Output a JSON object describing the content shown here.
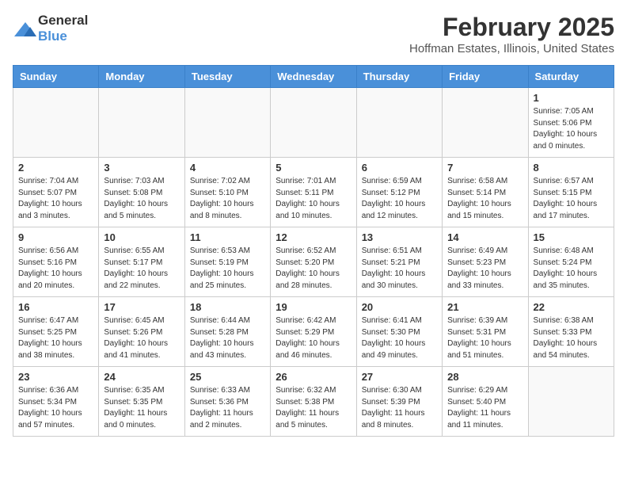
{
  "header": {
    "logo_general": "General",
    "logo_blue": "Blue",
    "month": "February 2025",
    "location": "Hoffman Estates, Illinois, United States"
  },
  "weekdays": [
    "Sunday",
    "Monday",
    "Tuesday",
    "Wednesday",
    "Thursday",
    "Friday",
    "Saturday"
  ],
  "weeks": [
    [
      {
        "day": "",
        "info": ""
      },
      {
        "day": "",
        "info": ""
      },
      {
        "day": "",
        "info": ""
      },
      {
        "day": "",
        "info": ""
      },
      {
        "day": "",
        "info": ""
      },
      {
        "day": "",
        "info": ""
      },
      {
        "day": "1",
        "info": "Sunrise: 7:05 AM\nSunset: 5:06 PM\nDaylight: 10 hours\nand 0 minutes."
      }
    ],
    [
      {
        "day": "2",
        "info": "Sunrise: 7:04 AM\nSunset: 5:07 PM\nDaylight: 10 hours\nand 3 minutes."
      },
      {
        "day": "3",
        "info": "Sunrise: 7:03 AM\nSunset: 5:08 PM\nDaylight: 10 hours\nand 5 minutes."
      },
      {
        "day": "4",
        "info": "Sunrise: 7:02 AM\nSunset: 5:10 PM\nDaylight: 10 hours\nand 8 minutes."
      },
      {
        "day": "5",
        "info": "Sunrise: 7:01 AM\nSunset: 5:11 PM\nDaylight: 10 hours\nand 10 minutes."
      },
      {
        "day": "6",
        "info": "Sunrise: 6:59 AM\nSunset: 5:12 PM\nDaylight: 10 hours\nand 12 minutes."
      },
      {
        "day": "7",
        "info": "Sunrise: 6:58 AM\nSunset: 5:14 PM\nDaylight: 10 hours\nand 15 minutes."
      },
      {
        "day": "8",
        "info": "Sunrise: 6:57 AM\nSunset: 5:15 PM\nDaylight: 10 hours\nand 17 minutes."
      }
    ],
    [
      {
        "day": "9",
        "info": "Sunrise: 6:56 AM\nSunset: 5:16 PM\nDaylight: 10 hours\nand 20 minutes."
      },
      {
        "day": "10",
        "info": "Sunrise: 6:55 AM\nSunset: 5:17 PM\nDaylight: 10 hours\nand 22 minutes."
      },
      {
        "day": "11",
        "info": "Sunrise: 6:53 AM\nSunset: 5:19 PM\nDaylight: 10 hours\nand 25 minutes."
      },
      {
        "day": "12",
        "info": "Sunrise: 6:52 AM\nSunset: 5:20 PM\nDaylight: 10 hours\nand 28 minutes."
      },
      {
        "day": "13",
        "info": "Sunrise: 6:51 AM\nSunset: 5:21 PM\nDaylight: 10 hours\nand 30 minutes."
      },
      {
        "day": "14",
        "info": "Sunrise: 6:49 AM\nSunset: 5:23 PM\nDaylight: 10 hours\nand 33 minutes."
      },
      {
        "day": "15",
        "info": "Sunrise: 6:48 AM\nSunset: 5:24 PM\nDaylight: 10 hours\nand 35 minutes."
      }
    ],
    [
      {
        "day": "16",
        "info": "Sunrise: 6:47 AM\nSunset: 5:25 PM\nDaylight: 10 hours\nand 38 minutes."
      },
      {
        "day": "17",
        "info": "Sunrise: 6:45 AM\nSunset: 5:26 PM\nDaylight: 10 hours\nand 41 minutes."
      },
      {
        "day": "18",
        "info": "Sunrise: 6:44 AM\nSunset: 5:28 PM\nDaylight: 10 hours\nand 43 minutes."
      },
      {
        "day": "19",
        "info": "Sunrise: 6:42 AM\nSunset: 5:29 PM\nDaylight: 10 hours\nand 46 minutes."
      },
      {
        "day": "20",
        "info": "Sunrise: 6:41 AM\nSunset: 5:30 PM\nDaylight: 10 hours\nand 49 minutes."
      },
      {
        "day": "21",
        "info": "Sunrise: 6:39 AM\nSunset: 5:31 PM\nDaylight: 10 hours\nand 51 minutes."
      },
      {
        "day": "22",
        "info": "Sunrise: 6:38 AM\nSunset: 5:33 PM\nDaylight: 10 hours\nand 54 minutes."
      }
    ],
    [
      {
        "day": "23",
        "info": "Sunrise: 6:36 AM\nSunset: 5:34 PM\nDaylight: 10 hours\nand 57 minutes."
      },
      {
        "day": "24",
        "info": "Sunrise: 6:35 AM\nSunset: 5:35 PM\nDaylight: 11 hours\nand 0 minutes."
      },
      {
        "day": "25",
        "info": "Sunrise: 6:33 AM\nSunset: 5:36 PM\nDaylight: 11 hours\nand 2 minutes."
      },
      {
        "day": "26",
        "info": "Sunrise: 6:32 AM\nSunset: 5:38 PM\nDaylight: 11 hours\nand 5 minutes."
      },
      {
        "day": "27",
        "info": "Sunrise: 6:30 AM\nSunset: 5:39 PM\nDaylight: 11 hours\nand 8 minutes."
      },
      {
        "day": "28",
        "info": "Sunrise: 6:29 AM\nSunset: 5:40 PM\nDaylight: 11 hours\nand 11 minutes."
      },
      {
        "day": "",
        "info": ""
      }
    ]
  ]
}
